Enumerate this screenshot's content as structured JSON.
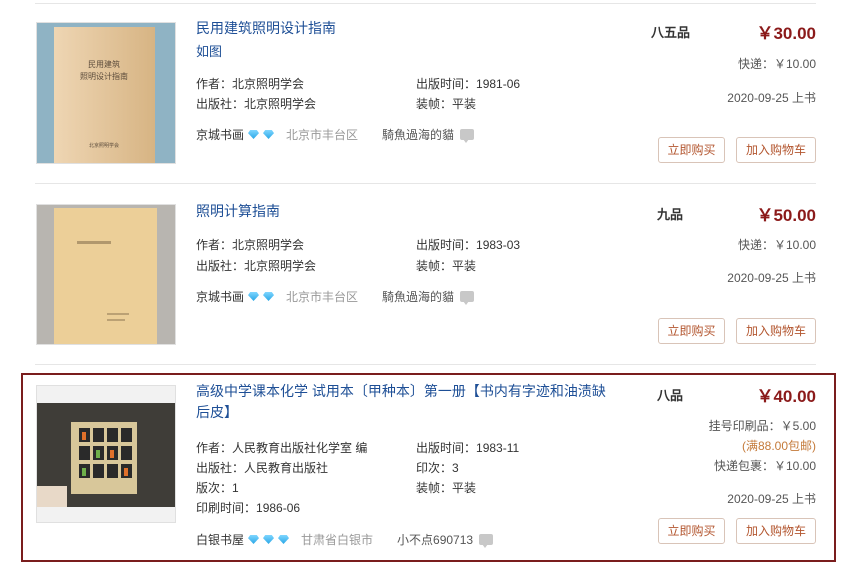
{
  "items": [
    {
      "title": "民用建筑照明设计指南",
      "subtitle": "如图",
      "fields": [
        {
          "k": "作者：",
          "v": "北京照明学会"
        },
        {
          "k": "出版社：",
          "v": "北京照明学会"
        },
        {
          "k": "出版时间：",
          "v": "1981-06"
        },
        {
          "k": "装帧：",
          "v": "平装"
        }
      ],
      "shop": {
        "name": "京城书画",
        "location": "北京市丰台区",
        "seller": "騎魚過海的貓"
      },
      "condition": "八五品",
      "price": "￥30.00",
      "shipping": "快递：￥10.00",
      "listed": "2020-09-25 上书",
      "buy_label": "立即购买",
      "cart_label": "加入购物车",
      "cover_text": [
        "民用建筑",
        "照明设计指南",
        "北京照明学会"
      ]
    },
    {
      "title": "照明计算指南",
      "fields": [
        {
          "k": "作者：",
          "v": "北京照明学会"
        },
        {
          "k": "出版社：",
          "v": "北京照明学会"
        },
        {
          "k": "出版时间：",
          "v": "1983-03"
        },
        {
          "k": "装帧：",
          "v": "平装"
        }
      ],
      "shop": {
        "name": "京城书画",
        "location": "北京市丰台区",
        "seller": "騎魚過海的貓"
      },
      "condition": "九品",
      "price": "￥50.00",
      "shipping": "快递：￥10.00",
      "listed": "2020-09-25 上书",
      "buy_label": "立即购买",
      "cart_label": "加入购物车"
    },
    {
      "title": "高级中学课本化学 试用本〔甲种本〕第一册【书内有字迹和油渍缺后皮】",
      "fields": [
        {
          "k": "作者：",
          "v": "人民教育出版社化学室 编"
        },
        {
          "k": "出版社：",
          "v": "人民教育出版社"
        },
        {
          "k": "版次：",
          "v": "1"
        },
        {
          "k": "印刷时间：",
          "v": "1986-06"
        },
        {
          "k": "出版时间：",
          "v": "1983-11"
        },
        {
          "k": "印次：",
          "v": "3"
        },
        {
          "k": "装帧：",
          "v": "平装"
        }
      ],
      "shop": {
        "name": "白银书屋",
        "location": "甘肃省白银市",
        "seller": "小不点690713"
      },
      "condition": "八品",
      "price": "￥40.00",
      "registered_mail": "挂号印刷品：￥5.00",
      "free_shipping": "(满88.00包邮)",
      "express": "快递包裹：￥10.00",
      "listed": "2020-09-25 上书",
      "buy_label": "立即购买",
      "cart_label": "加入购物车"
    }
  ],
  "colors": {
    "accent": "#8b1a1a",
    "link": "#1e4f96",
    "highlight_border": "#7a1d1d"
  }
}
